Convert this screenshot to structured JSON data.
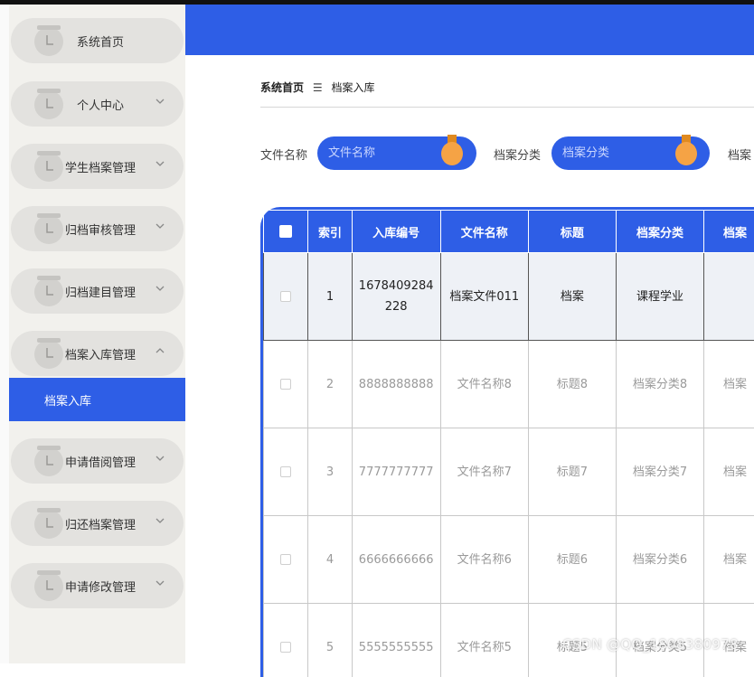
{
  "sidebar": {
    "items": [
      {
        "label": "系统首页",
        "has_chevron": false
      },
      {
        "label": "个人中心",
        "has_chevron": true
      },
      {
        "label": "学生档案管理",
        "has_chevron": true
      },
      {
        "label": "归档审核管理",
        "has_chevron": true
      },
      {
        "label": "归档建目管理",
        "has_chevron": true
      },
      {
        "label": "档案入库管理",
        "has_chevron": true,
        "expanded": true
      },
      {
        "label": "申请借阅管理",
        "has_chevron": true
      },
      {
        "label": "归还档案管理",
        "has_chevron": true
      },
      {
        "label": "申请修改管理",
        "has_chevron": true
      }
    ],
    "active_subitem": "档案入库"
  },
  "breadcrumb": {
    "home": "系统首页",
    "separator": "☰",
    "current": "档案入库"
  },
  "search": {
    "fields": [
      {
        "label": "文件名称",
        "placeholder": "文件名称"
      },
      {
        "label": "档案分类",
        "placeholder": "档案分类"
      },
      {
        "label": "档案"
      }
    ]
  },
  "table": {
    "headers": [
      "",
      "索引",
      "入库编号",
      "文件名称",
      "标题",
      "档案分类",
      "档案"
    ],
    "rows": [
      {
        "index": "1",
        "code": "1678409284228",
        "name": "档案文件011",
        "title": "档案",
        "category": "课程学业",
        "extra": ""
      },
      {
        "index": "2",
        "code": "8888888888",
        "name": "文件名称8",
        "title": "标题8",
        "category": "档案分类8",
        "extra": "档案"
      },
      {
        "index": "3",
        "code": "7777777777",
        "name": "文件名称7",
        "title": "标题7",
        "category": "档案分类7",
        "extra": "档案"
      },
      {
        "index": "4",
        "code": "6666666666",
        "name": "文件名称6",
        "title": "标题6",
        "category": "档案分类6",
        "extra": "档案"
      },
      {
        "index": "5",
        "code": "5555555555",
        "name": "文件名称5",
        "title": "标题5",
        "category": "档案分类5",
        "extra": "档案"
      }
    ]
  },
  "watermark": "CSDN @QQ_1808380978",
  "colors": {
    "primary": "#2e5ee6",
    "sidebar_bg": "#f2f1ed",
    "pill_ornament": "#f5a345"
  }
}
